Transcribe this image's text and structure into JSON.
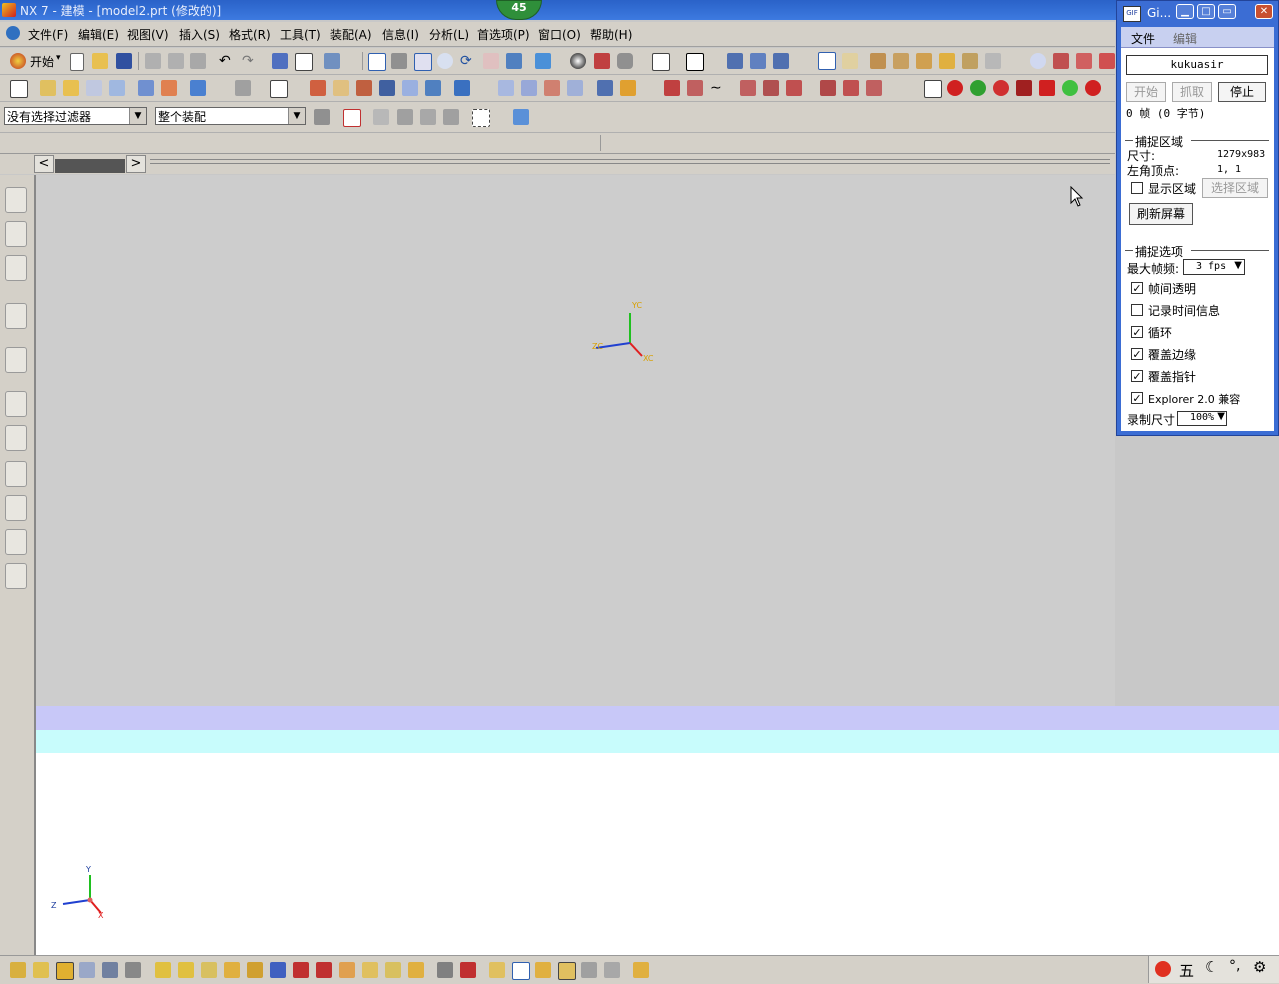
{
  "titlebar": {
    "title": "NX 7 - 建模 - [model2.prt (修改的)]",
    "badge": "45"
  },
  "menu": [
    {
      "label": "文件(F)"
    },
    {
      "label": "编辑(E)"
    },
    {
      "label": "视图(V)"
    },
    {
      "label": "插入(S)"
    },
    {
      "label": "格式(R)"
    },
    {
      "label": "工具(T)"
    },
    {
      "label": "装配(A)"
    },
    {
      "label": "信息(I)"
    },
    {
      "label": "分析(L)"
    },
    {
      "label": "首选项(P)"
    },
    {
      "label": "窗口(O)"
    },
    {
      "label": "帮助(H)"
    }
  ],
  "toolbar": {
    "start_label": "开始"
  },
  "filters": {
    "selection_filter": "没有选择过滤器",
    "assembly_scope": "整个装配"
  },
  "viewport": {
    "csys_top": {
      "x_label": "XC",
      "y_label": "YC",
      "z_label": "ZC"
    },
    "csys_bottom": {
      "x_label": "X",
      "y_label": "Y",
      "z_label": "Z"
    }
  },
  "tray": {
    "ime_label": "五"
  },
  "gif": {
    "title": "Gi...",
    "menu_file": "文件",
    "menu_edit": "编辑",
    "name": "kukuasir",
    "btn_start": "开始",
    "btn_capture": "抓取",
    "btn_stop": "停止",
    "frames_info": "0 帧 (0 字节)",
    "capture_area": {
      "heading": "捕捉区域",
      "size_label": "尺寸:",
      "size_value": "1279x983",
      "corner_label": "左角顶点:",
      "corner_value": "1, 1",
      "show_area": "显示区域",
      "select_area": "选择区域",
      "refresh": "刷新屏幕"
    },
    "capture_options": {
      "heading": "捕捉选项",
      "max_fps_label": "最大帧频:",
      "max_fps_value": "3 fps",
      "opt_transparent": "帧间透明",
      "opt_timeinfo": "记录时间信息",
      "opt_loop": "循环",
      "opt_edge": "覆盖边缘",
      "opt_pointer": "覆盖指针",
      "opt_explorer": "Explorer 2.0 兼容",
      "record_size_label": "录制尺寸",
      "record_size_value": "100%"
    },
    "checks": {
      "transparent": true,
      "timeinfo": false,
      "loop": true,
      "edge": true,
      "pointer": true,
      "explorer": true,
      "show_area": false
    }
  },
  "colors": {
    "accent": "#3b6dd4",
    "viewport_bg": "#cdcdcd",
    "stripe_lavender": "#c8c8f8",
    "stripe_cyan": "#c8fcfc"
  }
}
